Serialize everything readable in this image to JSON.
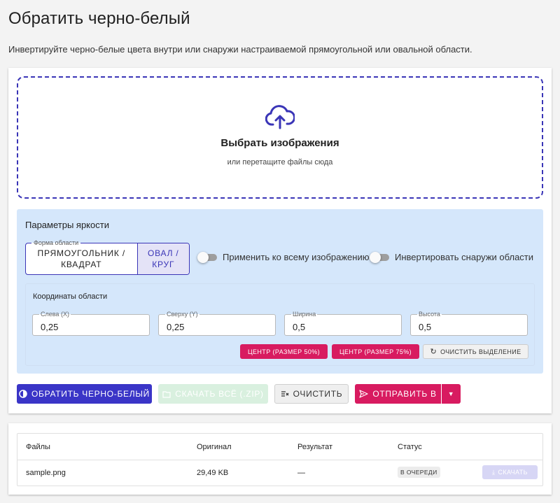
{
  "page": {
    "title": "Обратить черно-белый",
    "description": "Инвертируйте черно-белые цвета внутри или снаружи настраиваемой прямоугольной или овальной области."
  },
  "dropzone": {
    "icon": "cloud-upload-icon",
    "title": "Выбрать изображения",
    "subtitle": "или перетащите файлы сюда"
  },
  "params": {
    "title": "Параметры яркости",
    "shape": {
      "legend": "Форма области",
      "options": [
        "ПРЯМОУГОЛЬНИК / КВАДРАТ",
        "ОВАЛ / КРУГ"
      ],
      "selected": "ОВАЛ / КРУГ"
    },
    "toggles": {
      "apply_whole": {
        "label": "Применить ко всему изображению",
        "on": false
      },
      "invert_outside": {
        "label": "Инвертировать снаружи области",
        "on": false
      }
    },
    "coords": {
      "title": "Координаты области",
      "fields": [
        {
          "label": "Слева (X)",
          "value": "0,25"
        },
        {
          "label": "Сверху (Y)",
          "value": "0,25"
        },
        {
          "label": "Ширина",
          "value": "0,5"
        },
        {
          "label": "Высота",
          "value": "0,5"
        }
      ],
      "buttons": {
        "center50": "ЦЕНТР (РАЗМЕР 50%)",
        "center75": "ЦЕНТР (РАЗМЕР 75%)",
        "clear_selection": "ОЧИСТИТЬ ВЫДЕЛЕНИЕ"
      }
    }
  },
  "actions": {
    "invert": "ОБРАТИТЬ ЧЕРНО-БЕЛЫЙ",
    "download_zip": "СКАЧАТЬ ВСЁ (.ZIP)",
    "clear": "ОЧИСТИТЬ",
    "send_to": "ОТПРАВИТЬ В"
  },
  "files": {
    "headers": [
      "Файлы",
      "Оригинал",
      "Результат",
      "Статус"
    ],
    "rows": [
      {
        "name": "sample.png",
        "original": "29,49 KB",
        "result": "—",
        "status": "В ОЧЕРЕДИ",
        "download": "СКАЧАТЬ"
      }
    ]
  },
  "colors": {
    "accent": "#3a35c7",
    "pink": "#d81b60",
    "params_bg": "#d5e7fb"
  }
}
